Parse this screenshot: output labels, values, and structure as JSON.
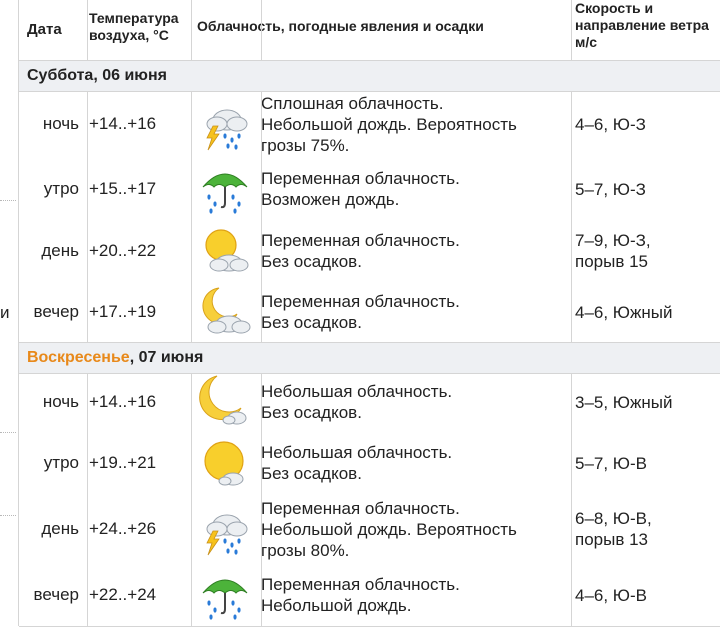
{
  "header": {
    "date": "Дата",
    "temp_line1": "Температура",
    "temp_line2": "воздуха, °С",
    "weather": "Облачность, погодные явления и осадки",
    "wind_line1": "Скорость и",
    "wind_line2": "направление ветра",
    "wind_line3": "м/с"
  },
  "gutter_char": "и",
  "days": [
    {
      "name": "Суббота",
      "date": ", 06 июня",
      "name_color": "#222222",
      "rows": [
        {
          "time": "ночь",
          "temp": "+14..+16",
          "icon": "storm-cloud-icon",
          "desc": [
            "Сплошная облачность.",
            "Небольшой дождь. Вероятность",
            "грозы 75%."
          ],
          "wind": [
            "4–6, Ю-З"
          ]
        },
        {
          "time": "утро",
          "temp": "+15..+17",
          "icon": "umbrella-rain-icon",
          "desc": [
            "Переменная облачность.",
            "Возможен дождь."
          ],
          "wind": [
            "5–7, Ю-З"
          ]
        },
        {
          "time": "день",
          "temp": "+20..+22",
          "icon": "sun-cloud-icon",
          "desc": [
            "Переменная облачность.",
            "Без осадков."
          ],
          "wind": [
            "7–9, Ю-З,",
            "порыв 15"
          ]
        },
        {
          "time": "вечер",
          "temp": "+17..+19",
          "icon": "moon-cloud-icon",
          "desc": [
            "Переменная облачность.",
            "Без осадков."
          ],
          "wind": [
            "4–6, Южный"
          ]
        }
      ]
    },
    {
      "name": "Воскресенье",
      "date": ", 07 июня",
      "name_color": "#e8891a",
      "rows": [
        {
          "time": "ночь",
          "temp": "+14..+16",
          "icon": "moon-small-cloud-icon",
          "desc": [
            "Небольшая облачность.",
            "Без осадков."
          ],
          "wind": [
            "3–5, Южный"
          ]
        },
        {
          "time": "утро",
          "temp": "+19..+21",
          "icon": "sun-small-cloud-icon",
          "desc": [
            "Небольшая облачность.",
            "Без осадков."
          ],
          "wind": [
            "5–7, Ю-В"
          ]
        },
        {
          "time": "день",
          "temp": "+24..+26",
          "icon": "storm-cloud-icon",
          "desc": [
            "Переменная облачность.",
            "Небольшой дождь. Вероятность",
            "грозы 80%."
          ],
          "wind": [
            "6–8, Ю-В,",
            "порыв 13"
          ]
        },
        {
          "time": "вечер",
          "temp": "+22..+24",
          "icon": "umbrella-rain-icon",
          "desc": [
            "Переменная облачность.",
            "Небольшой дождь."
          ],
          "wind": [
            "4–6, Ю-В"
          ]
        }
      ]
    }
  ]
}
